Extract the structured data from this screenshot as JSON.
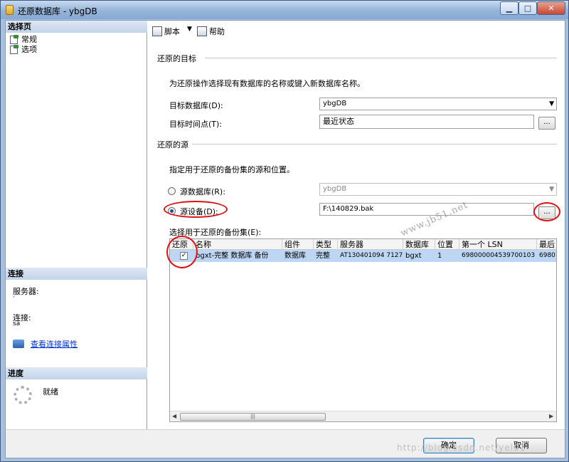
{
  "window": {
    "title": "还原数据库 - ybgDB"
  },
  "left": {
    "select_page_header": "选择页",
    "pages": [
      {
        "label": "常规"
      },
      {
        "label": "选项"
      }
    ],
    "connection_header": "连接",
    "server_label": "服务器:",
    "server_value": "·",
    "connection_label": "连接:",
    "connection_value": "sa",
    "view_link": "查看连接属性",
    "progress_header": "进度",
    "progress_status": "就绪"
  },
  "toolbar": {
    "script_label": "脚本",
    "help_label": "帮助"
  },
  "target": {
    "group_title": "还原的目标",
    "description": "为还原操作选择现有数据库的名称或键入新数据库名称。",
    "db_label": "目标数据库(D):",
    "db_value": "ybgDB",
    "time_label": "目标时间点(T):",
    "time_value": "最近状态",
    "ellipsis": "..."
  },
  "source": {
    "group_title": "还原的源",
    "description": "指定用于还原的备份集的源和位置。",
    "from_db_label": "源数据库(R):",
    "from_db_value": "ybgDB",
    "from_device_label": "源设备(D):",
    "from_device_value": "F:\\140829.bak",
    "ellipsis": "..."
  },
  "backup_sets": {
    "label": "选择用于还原的备份集(E):",
    "columns": [
      "还原",
      "名称",
      "组件",
      "类型",
      "服务器",
      "数据库",
      "位置",
      "第一个 LSN",
      "最后"
    ],
    "rows": [
      {
        "restore": true,
        "name": "bgxt-完整 数据库 备份",
        "component": "数据库",
        "type": "完整",
        "server": "AT130401094 7127",
        "database": "bgxt",
        "position": "1",
        "first_lsn": "698000004539700103",
        "last_lsn": "6980"
      }
    ],
    "scroll_grip": "|||"
  },
  "buttons": {
    "ok": "确定",
    "cancel": "取消"
  },
  "watermarks": {
    "diagonal": "www.jb51.net",
    "bottom": "http://blog.csdn.net/yel01"
  }
}
